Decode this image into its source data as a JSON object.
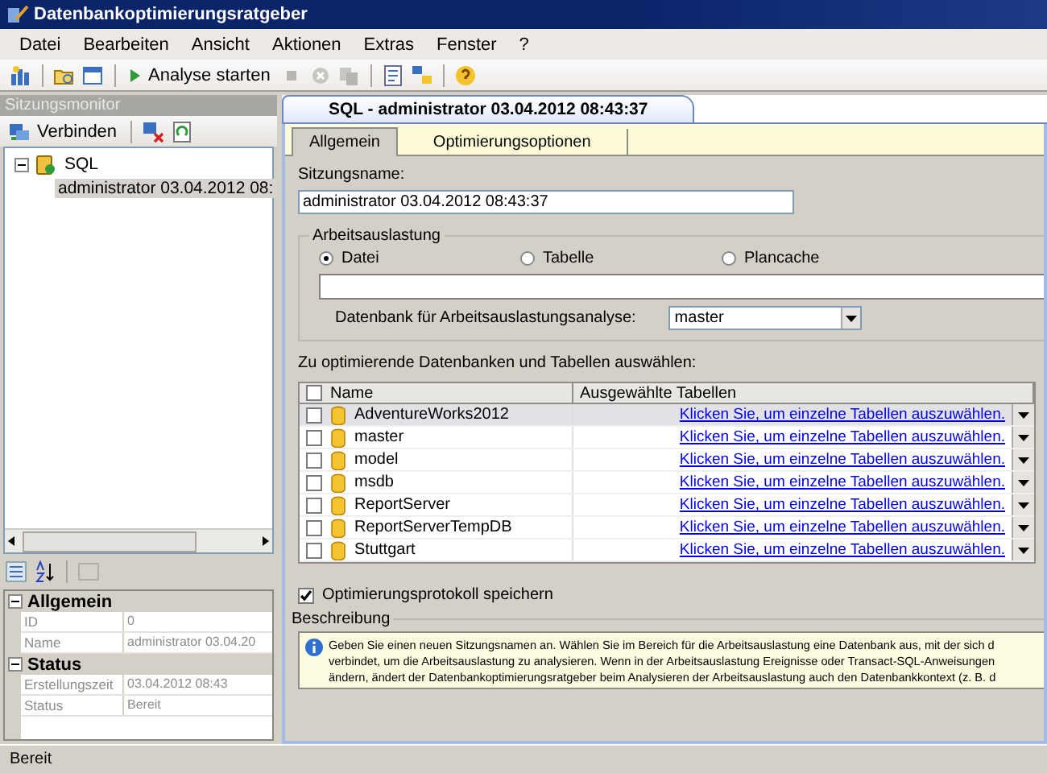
{
  "window": {
    "title": "Datenbankoptimierungsratgeber"
  },
  "menu": [
    "Datei",
    "Bearbeiten",
    "Ansicht",
    "Aktionen",
    "Extras",
    "Fenster",
    "?"
  ],
  "toolbar": {
    "start_button": "Analyse starten"
  },
  "session_monitor": {
    "title": "Sitzungsmonitor",
    "connect_button": "Verbinden",
    "tree": [
      {
        "label": "SQL",
        "expanded": true,
        "selected": false,
        "children": [
          {
            "label": "administrator 03.04.2012 08:",
            "selected": true
          }
        ]
      }
    ]
  },
  "properties": {
    "categories": [
      {
        "name": "Allgemein",
        "expanded": true,
        "rows": [
          {
            "name": "ID",
            "value": "0"
          },
          {
            "name": "Name",
            "value": "administrator 03.04.20"
          }
        ]
      },
      {
        "name": "Status",
        "expanded": true,
        "rows": [
          {
            "name": "Erstellungszeit",
            "value": "03.04.2012 08:43"
          },
          {
            "name": "Status",
            "value": "Bereit"
          }
        ]
      }
    ]
  },
  "document": {
    "tab": {
      "label": "SQL - administrator 03.04.2012 08:43:37",
      "selected": true
    },
    "tabs": [
      {
        "label": "Allgemein",
        "selected": true
      },
      {
        "label": "Optimierungsoptionen",
        "selected": false
      }
    ],
    "session_name": {
      "label": "Sitzungsname:",
      "value": "administrator 03.04.2012 08:43:37"
    },
    "workload": {
      "title": "Arbeitsauslastung",
      "options": [
        {
          "label": "Datei",
          "selected": true
        },
        {
          "label": "Tabelle",
          "selected": false
        },
        {
          "label": "Plancache",
          "selected": false
        }
      ],
      "database_label": "Datenbank für Arbeitsauslastungsanalyse:",
      "database_value": "master"
    },
    "databases": {
      "label": "Zu optimierende Datenbanken und Tabellen auswählen:",
      "all_checked": false,
      "columns": [
        "Name",
        "Ausgewählte Tabellen"
      ],
      "rows": [
        {
          "name": "AdventureWorks2012",
          "checked": false,
          "selected": true,
          "tables": "Klicken Sie, um einzelne Tabellen auszuwählen."
        },
        {
          "name": "master",
          "checked": false,
          "selected": false,
          "tables": "Klicken Sie, um einzelne Tabellen auszuwählen."
        },
        {
          "name": "model",
          "checked": false,
          "selected": false,
          "tables": "Klicken Sie, um einzelne Tabellen auszuwählen."
        },
        {
          "name": "msdb",
          "checked": false,
          "selected": false,
          "tables": "Klicken Sie, um einzelne Tabellen auszuwählen."
        },
        {
          "name": "ReportServer",
          "checked": false,
          "selected": false,
          "tables": "Klicken Sie, um einzelne Tabellen auszuwählen."
        },
        {
          "name": "ReportServerTempDB",
          "checked": false,
          "selected": false,
          "tables": "Klicken Sie, um einzelne Tabellen auszuwählen."
        },
        {
          "name": "Stuttgart",
          "checked": false,
          "selected": false,
          "tables": "Klicken Sie, um einzelne Tabellen auszuwählen."
        }
      ]
    },
    "save_log": {
      "label": "Optimierungsprotokoll speichern",
      "checked": true
    },
    "description": {
      "title": "Beschreibung",
      "lines": [
        "Geben Sie einen neuen Sitzungsnamen an. Wählen Sie im Bereich für die Arbeitsauslastung eine Datenbank aus, mit der sich d",
        "verbindet, um die Arbeitsauslastung zu analysieren. Wenn in der Arbeitsauslastung Ereignisse oder Transact-SQL-Anweisungen",
        "ändern, ändert der Datenbankoptimierungsratgeber beim Analysieren der Arbeitsauslastung auch den Datenbankkontext (z. B. d"
      ]
    }
  },
  "status_bar": "Bereit"
}
